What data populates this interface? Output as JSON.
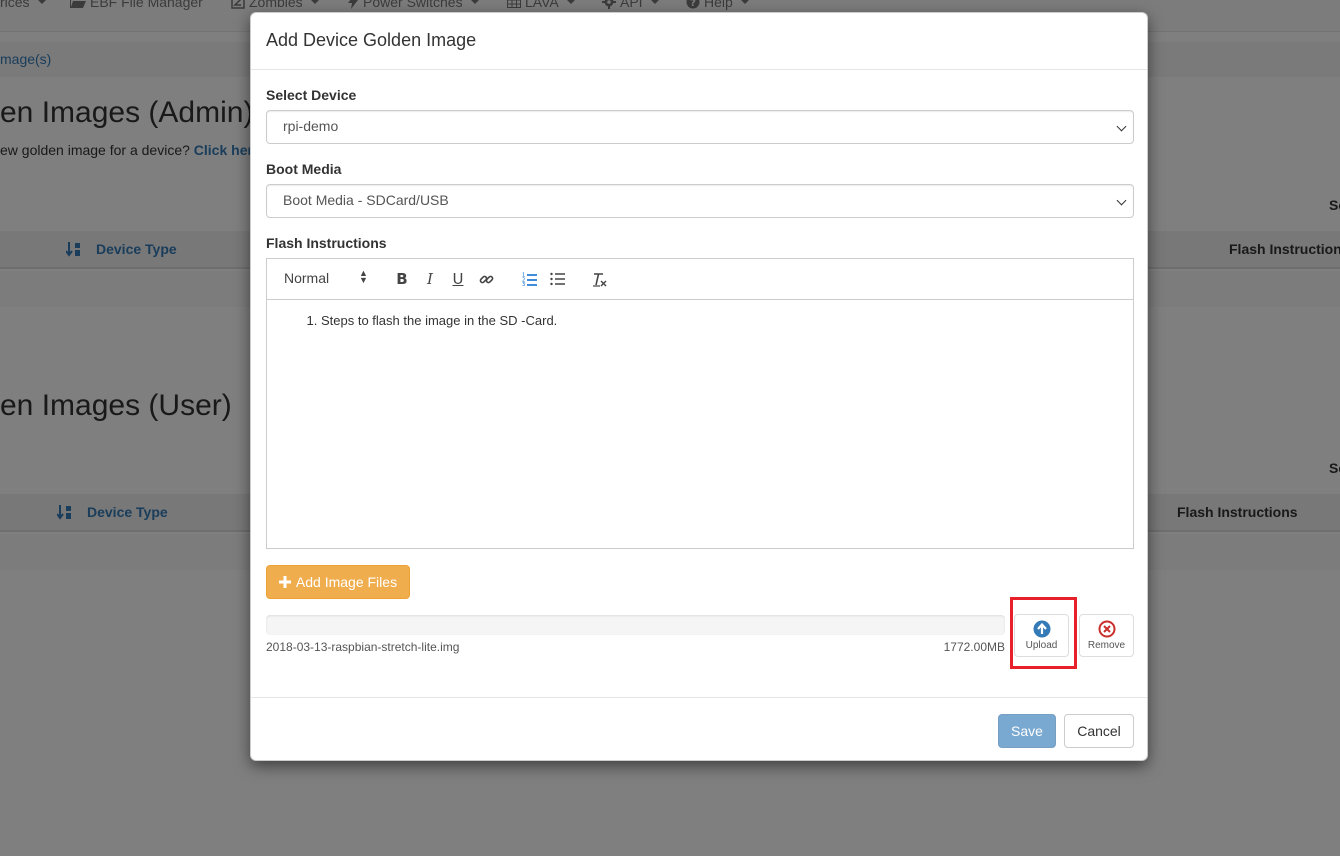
{
  "navbar": {
    "items": [
      {
        "label": "rices",
        "icon": "none"
      },
      {
        "label": "EBF File Manager",
        "icon": "folder-open-icon"
      },
      {
        "label": "Zombies",
        "icon": "zombie-box-icon"
      },
      {
        "label": "Power Switches",
        "icon": "bolt-icon"
      },
      {
        "label": "LAVA",
        "icon": "table-icon"
      },
      {
        "label": "API",
        "icon": "gear-icon"
      },
      {
        "label": "Help",
        "icon": "question-circle-icon"
      }
    ]
  },
  "breadcrumb": {
    "text": "mage(s)"
  },
  "admin_section": {
    "title": "en Images (Admin)",
    "desc_prefix": "ew golden image for a device?",
    "desc_link": "Click her",
    "search_label": "Se",
    "col_device_type": "Device Type",
    "col_flash": "Flash Instruction"
  },
  "user_section": {
    "title": "en Images (User)",
    "search_label": "Se",
    "col_device_type": "Device Type",
    "col_flash": "Flash Instructions"
  },
  "modal": {
    "title": "Add Device Golden Image",
    "select_device_label": "Select Device",
    "select_device_value": "rpi-demo",
    "boot_media_label": "Boot Media",
    "boot_media_value": "Boot Media - SDCard/USB",
    "flash_label": "Flash Instructions",
    "editor": {
      "header_format": "Normal",
      "tools": [
        "bold-icon",
        "italic-icon",
        "underline-icon",
        "link-icon",
        "ordered-list-icon",
        "bullet-list-icon",
        "clear-format-icon"
      ],
      "content_items": [
        "Steps to flash the image in the SD -Card."
      ]
    },
    "add_files_label": "Add Image Files",
    "file": {
      "name": "2018-03-13-raspbian-stretch-lite.img",
      "size": "1772.00MB",
      "progress": 0
    },
    "upload_label": "Upload",
    "remove_label": "Remove",
    "save_label": "Save",
    "cancel_label": "Cancel"
  },
  "colors": {
    "primary": "#337ab7",
    "warning": "#f0ad4e",
    "danger": "#d9534f",
    "highlight": "#e8202a"
  }
}
